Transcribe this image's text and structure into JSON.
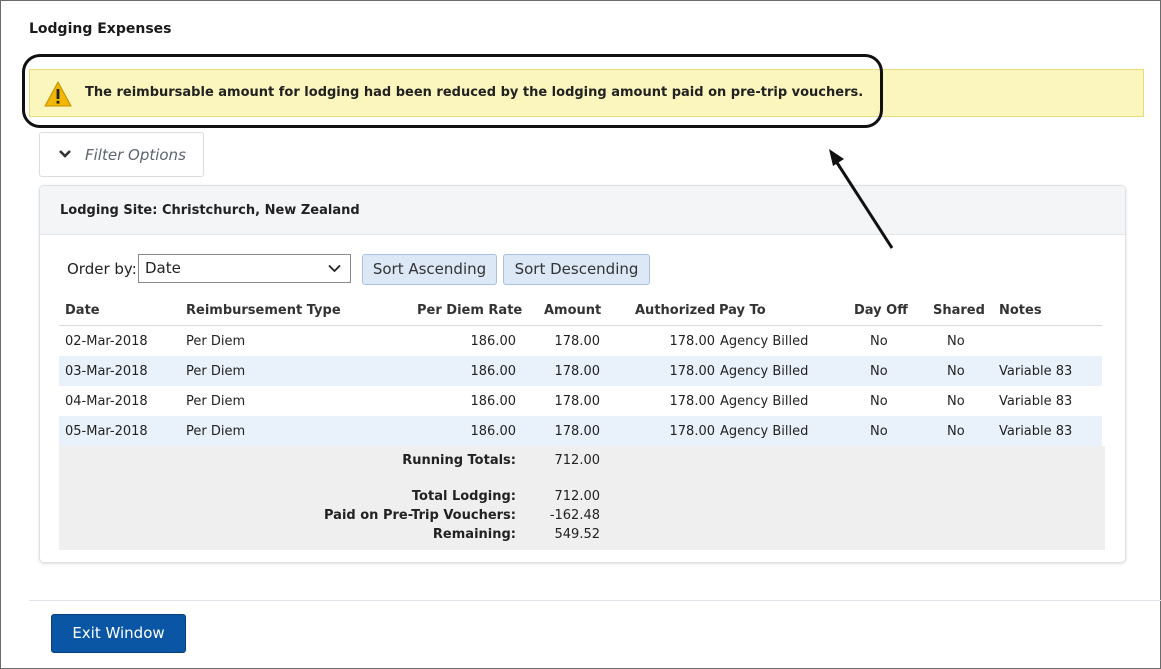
{
  "section": {
    "title": "Lodging Expenses"
  },
  "warning": {
    "message": "The reimbursable amount for lodging had been reduced by the lodging amount paid on pre-trip vouchers.",
    "icon": "warning-triangle-icon",
    "bg": "#fbf6bd"
  },
  "filter": {
    "label": "Filter Options",
    "icon": "chevron-down-icon"
  },
  "panel": {
    "title": "Lodging Site: Christchurch, New Zealand"
  },
  "order": {
    "label": "Order by:",
    "selected": "Date",
    "asc_label": "Sort Ascending",
    "desc_label": "Sort Descending"
  },
  "table": {
    "headers": [
      "Date",
      "Reimbursement Type",
      "Per Diem Rate",
      "Amount",
      "Authorized",
      "Pay To",
      "Day Off",
      "Shared",
      "Notes"
    ],
    "rows": [
      [
        "02-Mar-2018",
        "Per Diem",
        "186.00",
        "178.00",
        "178.00",
        "Agency Billed",
        "No",
        "No",
        ""
      ],
      [
        "03-Mar-2018",
        "Per Diem",
        "186.00",
        "178.00",
        "178.00",
        "Agency Billed",
        "No",
        "No",
        "Variable 83"
      ],
      [
        "04-Mar-2018",
        "Per Diem",
        "186.00",
        "178.00",
        "178.00",
        "Agency Billed",
        "No",
        "No",
        "Variable 83"
      ],
      [
        "05-Mar-2018",
        "Per Diem",
        "186.00",
        "178.00",
        "178.00",
        "Agency Billed",
        "No",
        "No",
        "Variable 83"
      ]
    ]
  },
  "totals": {
    "running_label": "Running Totals:",
    "running_value": "712.00",
    "total_label": "Total Lodging:",
    "total_value": "712.00",
    "paid_label": "Paid on Pre-Trip Vouchers:",
    "paid_value": "-162.48",
    "remaining_label": "Remaining:",
    "remaining_value": "549.52"
  },
  "footer": {
    "exit_label": "Exit Window"
  },
  "colors": {
    "accent": "#0a56a5",
    "alt_row": "#e9f1fb",
    "sort_btn": "#dde8f6"
  }
}
